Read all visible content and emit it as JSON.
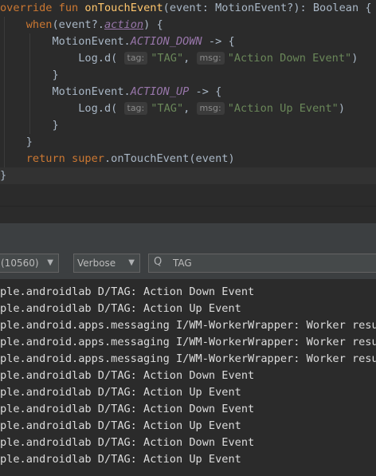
{
  "editor": {
    "lines": [
      [
        {
          "t": "override ",
          "c": "kw"
        },
        {
          "t": "fun ",
          "c": "kw"
        },
        {
          "t": "onTouchEvent",
          "c": "fn"
        },
        {
          "t": "(event: MotionEvent?): Boolean {"
        }
      ],
      [
        {
          "t": "    "
        },
        {
          "t": "when",
          "c": "kw"
        },
        {
          "t": "(event?."
        },
        {
          "t": "action",
          "c": "it ul"
        },
        {
          "t": ") {"
        }
      ],
      [
        {
          "t": "        MotionEvent."
        },
        {
          "t": "ACTION_DOWN",
          "c": "it"
        },
        {
          "t": " -> {"
        }
      ],
      [
        {
          "t": "            Log.d( "
        },
        {
          "t": "tag:",
          "c": "hint"
        },
        {
          "t": "\"TAG\"",
          "c": "str"
        },
        {
          "t": ", "
        },
        {
          "t": "msg:",
          "c": "hint"
        },
        {
          "t": "\"Action Down Event\"",
          "c": "str"
        },
        {
          "t": ")"
        }
      ],
      [
        {
          "t": "        }"
        }
      ],
      [
        {
          "t": "        MotionEvent."
        },
        {
          "t": "ACTION_UP",
          "c": "it"
        },
        {
          "t": " -> {"
        }
      ],
      [
        {
          "t": "            Log.d( "
        },
        {
          "t": "tag:",
          "c": "hint"
        },
        {
          "t": "\"TAG\"",
          "c": "str"
        },
        {
          "t": ", "
        },
        {
          "t": "msg:",
          "c": "hint"
        },
        {
          "t": "\"Action Up Event\"",
          "c": "str"
        },
        {
          "t": ")"
        }
      ],
      [
        {
          "t": "        }"
        }
      ],
      [
        {
          "t": "    }"
        }
      ],
      [
        {
          "t": "    "
        },
        {
          "t": "return ",
          "c": "kw"
        },
        {
          "t": "super",
          "c": "kw"
        },
        {
          "t": ".onTouchEvent(event)"
        }
      ],
      [
        {
          "t": "}"
        }
      ]
    ]
  },
  "toolbar": {
    "process_label": "(10560)",
    "level_label": "Verbose",
    "search_value": "TAG",
    "arrow_glyph": "▼",
    "search_icon_glyph": "Q"
  },
  "logcat": {
    "lines": [
      "ple.androidlab D/TAG: Action Down Event",
      "ple.androidlab D/TAG: Action Up Event",
      "ple.android.apps.messaging I/WM-WorkerWrapper: Worker result",
      "ple.android.apps.messaging I/WM-WorkerWrapper: Worker result",
      "ple.android.apps.messaging I/WM-WorkerWrapper: Worker result",
      "ple.androidlab D/TAG: Action Down Event",
      "ple.androidlab D/TAG: Action Up Event",
      "ple.androidlab D/TAG: Action Down Event",
      "ple.androidlab D/TAG: Action Up Event",
      "ple.androidlab D/TAG: Action Down Event",
      "ple.androidlab D/TAG: Action Up Event"
    ]
  }
}
